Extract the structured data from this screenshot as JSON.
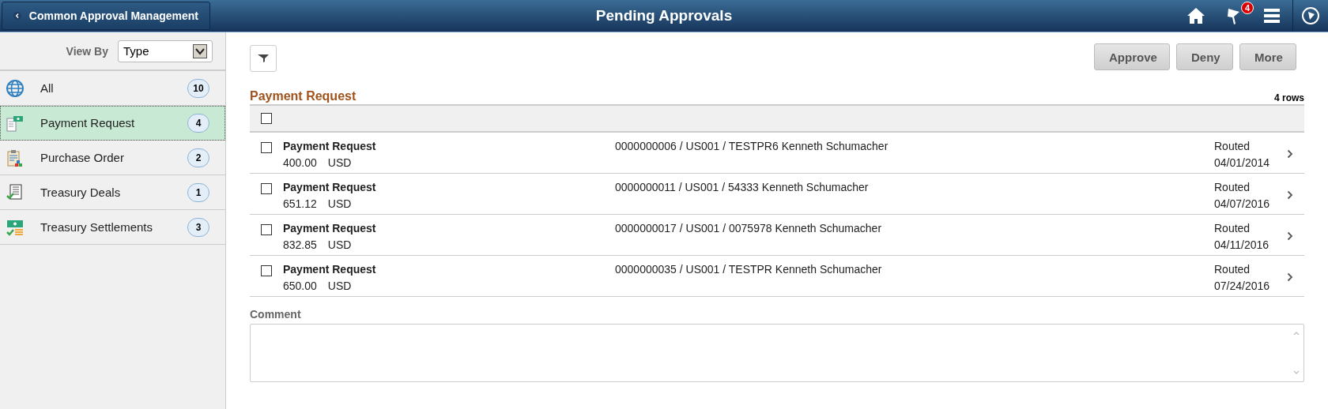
{
  "header": {
    "back_label": "Common Approval Management",
    "title": "Pending Approvals",
    "notification_count": "4"
  },
  "sidebar": {
    "view_by_label": "View By",
    "view_by_value": "Type",
    "items": [
      {
        "label": "All",
        "count": "10",
        "selected": false
      },
      {
        "label": "Payment Request",
        "count": "4",
        "selected": true
      },
      {
        "label": "Purchase Order",
        "count": "2",
        "selected": false
      },
      {
        "label": "Treasury Deals",
        "count": "1",
        "selected": false
      },
      {
        "label": "Treasury Settlements",
        "count": "3",
        "selected": false
      }
    ]
  },
  "actions": [
    "Approve",
    "Deny",
    "More"
  ],
  "grid": {
    "title": "Payment Request",
    "row_count": "4 rows",
    "select_all_checked": false,
    "rows": [
      {
        "checked": false,
        "type": "Payment Request",
        "amount": "400.00",
        "currency": "USD",
        "description": "0000000006 / US001 / TESTPR6 Kenneth Schumacher",
        "status": "Routed",
        "date": "04/01/2014"
      },
      {
        "checked": false,
        "type": "Payment Request",
        "amount": "651.12",
        "currency": "USD",
        "description": "0000000011 / US001 / 54333 Kenneth Schumacher",
        "status": "Routed",
        "date": "04/07/2016"
      },
      {
        "checked": false,
        "type": "Payment Request",
        "amount": "832.85",
        "currency": "USD",
        "description": "0000000017 / US001 / 0075978 Kenneth Schumacher",
        "status": "Routed",
        "date": "04/11/2016"
      },
      {
        "checked": false,
        "type": "Payment Request",
        "amount": "650.00",
        "currency": "USD",
        "description": "0000000035 / US001 / TESTPR Kenneth Schumacher",
        "status": "Routed",
        "date": "07/24/2016"
      }
    ]
  },
  "comment": {
    "label": "Comment"
  }
}
